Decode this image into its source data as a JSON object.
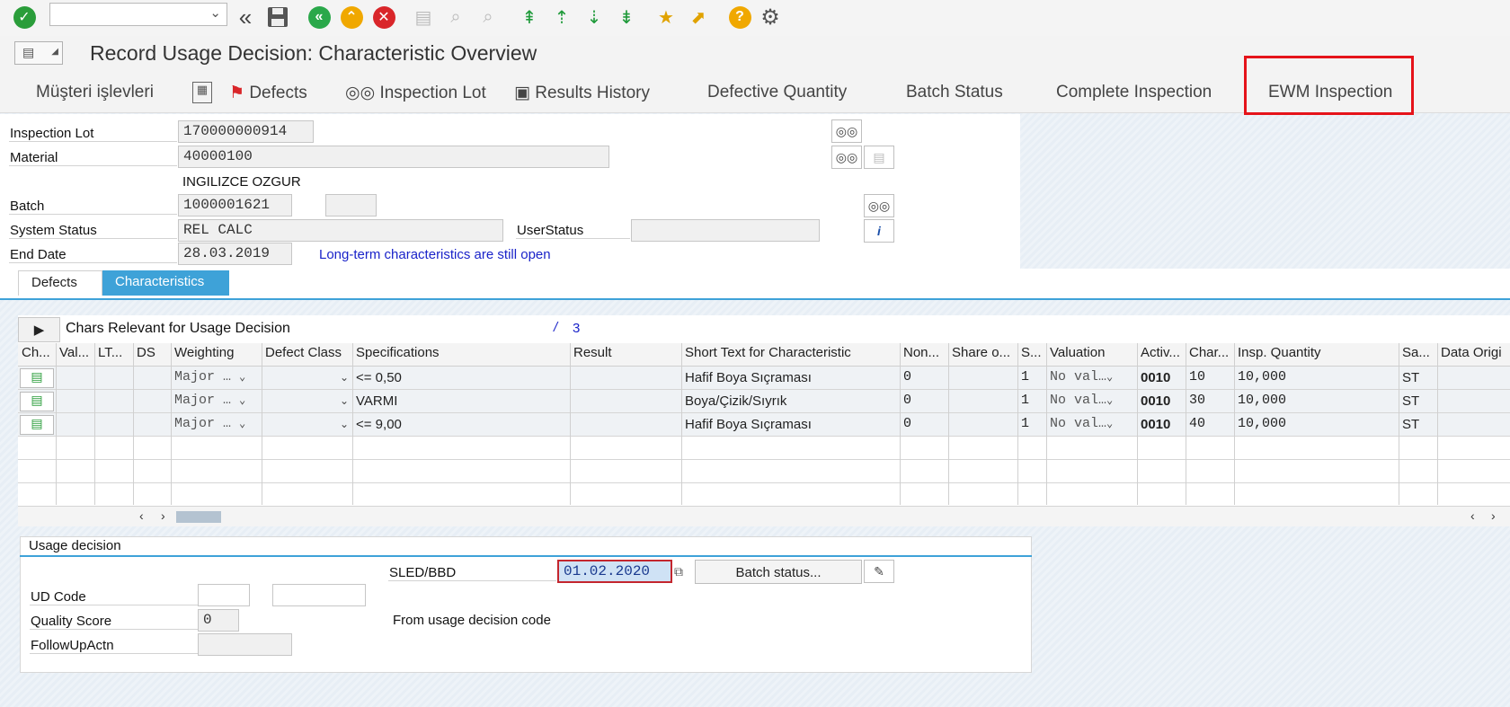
{
  "toolbar": {
    "command_field_value": "",
    "icons": [
      "enter-icon",
      "back-nav-icon",
      "save-icon",
      "back-icon",
      "exit-icon",
      "cancel-icon",
      "print-icon",
      "find-icon",
      "find-next-icon",
      "first-page-icon",
      "previous-page-icon",
      "next-page-icon",
      "last-page-icon",
      "create-session-icon",
      "shortcut-icon",
      "help-icon",
      "settings-icon"
    ]
  },
  "title": "Record Usage Decision: Characteristic Overview",
  "app_toolbar": {
    "musteri": "Müşteri işlevleri",
    "defects": "Defects",
    "inspection_lot": "Inspection Lot",
    "results_history": "Results History",
    "defective_quantity": "Defective Quantity",
    "batch_status": "Batch Status",
    "complete_inspection": "Complete Inspection",
    "ewm_inspection": "EWM Inspection"
  },
  "header": {
    "inspection_lot_label": "Inspection Lot",
    "inspection_lot_value": "170000000914",
    "material_label": "Material",
    "material_value": "40000100",
    "material_text": "INGILIZCE OZGUR",
    "batch_label": "Batch",
    "batch_value": "1000001621",
    "batch_extra": "",
    "system_status_label": "System Status",
    "system_status_value": "REL  CALC",
    "user_status_label": "UserStatus",
    "user_status_value": "",
    "end_date_label": "End Date",
    "end_date_value": "28.03.2019",
    "message": "Long-term characteristics are still open"
  },
  "tabs": {
    "defects": "Defects",
    "characteristics": "Characteristics"
  },
  "table": {
    "title": "Chars Relevant for Usage Decision",
    "slash": "/",
    "count": "3",
    "columns": [
      "Ch...",
      "Val...",
      "LT...",
      "DS",
      "Weighting",
      "Defect Class",
      "Specifications",
      "Result",
      "Short Text for Characteristic",
      "Non...",
      "Share o...",
      "S...",
      "Valuation",
      "Activ...",
      "Char...",
      "Insp. Quantity",
      "Sa...",
      "Data Origi"
    ],
    "rows": [
      {
        "weighting": "Major …",
        "spec": "<=  0,50",
        "short_text": "Hafif Boya Sıçraması",
        "non": "0",
        "s": "1",
        "valuation": "No val…",
        "activ": "0010",
        "char": "10",
        "insp_qty": "10,000",
        "sa": "ST"
      },
      {
        "weighting": "Major …",
        "spec": "VARMI",
        "short_text": "Boya/Çizik/Sıyrık",
        "non": "0",
        "s": "1",
        "valuation": "No val…",
        "activ": "0010",
        "char": "30",
        "insp_qty": "10,000",
        "sa": "ST"
      },
      {
        "weighting": "Major …",
        "spec": "<=  9,00",
        "short_text": "Hafif Boya Sıçraması",
        "non": "0",
        "s": "1",
        "valuation": "No val…",
        "activ": "0010",
        "char": "40",
        "insp_qty": "10,000",
        "sa": "ST"
      }
    ]
  },
  "usage_decision": {
    "section_title": "Usage decision",
    "sled_label": "SLED/BBD",
    "sled_value": "01.02.2020",
    "batch_status_button": "Batch status...",
    "ud_code_label": "UD Code",
    "ud_code_value": "",
    "ud_code_text": "",
    "quality_score_label": "Quality Score",
    "quality_score_value": "0",
    "followup_label": "FollowUpActn",
    "followup_value": "",
    "from_text": "From usage decision code"
  }
}
